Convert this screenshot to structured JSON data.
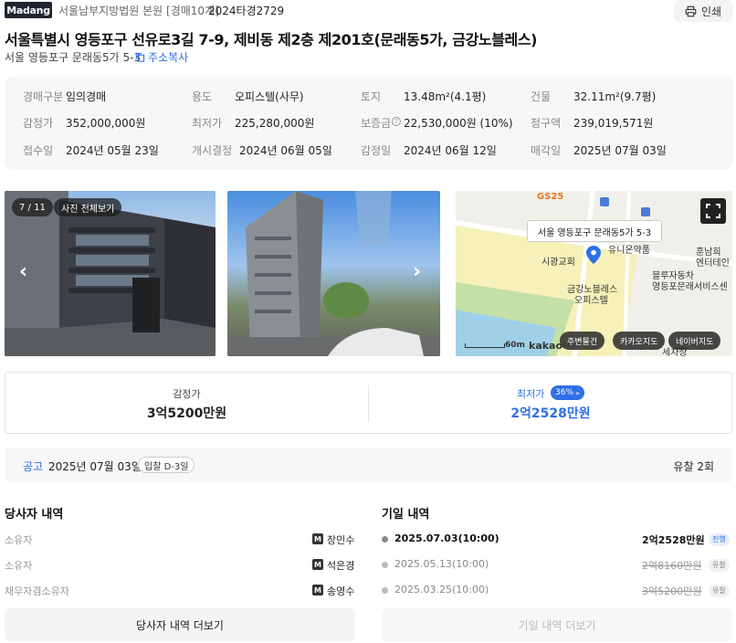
{
  "header": {
    "logo": "Madang",
    "court": "서울남부지방법원 본원 [경매10계]",
    "case_no": "2024타경2729",
    "print_label": "인쇄",
    "title": "서울특별시 영등포구 선유로3길 7-9, 제비동 제2층 제201호(문래동5가, 금강노블레스)",
    "sub_address": "서울 영등포구 문래동5가 5-3",
    "copy_label": "주소복사"
  },
  "info": [
    {
      "k": "경매구분",
      "v": "임의경매"
    },
    {
      "k": "용도",
      "v": "오피스텔(사무)"
    },
    {
      "k": "토지",
      "v": "13.48m²(4.1평)"
    },
    {
      "k": "건물",
      "v": "32.11m²(9.7평)"
    },
    {
      "k": "감정가",
      "v": "352,000,000원"
    },
    {
      "k": "최저가",
      "v": "225,280,000원"
    },
    {
      "k": "보증금",
      "v": "22,530,000원 (10%)"
    },
    {
      "k": "청구액",
      "v": "239,019,571원"
    },
    {
      "k": "접수일",
      "v": "2024년 05월 23일"
    },
    {
      "k": "개시결정",
      "v": "2024년 06월 05일"
    },
    {
      "k": "감정일",
      "v": "2024년 06월 12일"
    },
    {
      "k": "매각일",
      "v": "2025년 07월 03일"
    }
  ],
  "photos": {
    "counter": "7 / 11",
    "view_all": "사진 전체보기"
  },
  "map": {
    "tooltip": "서울 영등포구 문래동5가 5-3",
    "labels": [
      "GS25",
      "유니온약품",
      "시광교회",
      "금강노블레스",
      "오피스텔",
      "블루자동차",
      "영등포문래서비스센",
      "훈남희",
      "엔터테인",
      "세차장"
    ],
    "scale": "60m",
    "brand": "kakao",
    "buttons": [
      "주변물건",
      "카카오지도",
      "네이버지도"
    ]
  },
  "prices": {
    "appraisal_label": "감정가",
    "appraisal_value": "3억5200만원",
    "min_label": "최저가",
    "min_pct": "36%",
    "min_value": "2억2528만원"
  },
  "notice": {
    "label": "공고",
    "date": "2025년 07월 03일",
    "dday": "입찰 D-3일",
    "fail_count": "유찰 2회"
  },
  "parties": {
    "title": "당사자 내역",
    "rows": [
      {
        "role": "소유자",
        "name": "장민수"
      },
      {
        "role": "소유자",
        "name": "석은경"
      },
      {
        "role": "채무자겸소유자",
        "name": "송영수"
      }
    ],
    "more": "당사자 내역 더보기"
  },
  "schedule": {
    "title": "기일 내역",
    "rows": [
      {
        "date": "2025.07.03(10:00)",
        "price": "2억2528만원",
        "status": "진행"
      },
      {
        "date": "2025.05.13(10:00)",
        "price": "2억8160만원",
        "status": "유찰"
      },
      {
        "date": "2025.03.25(10:00)",
        "price": "3억5200만원",
        "status": "유찰"
      }
    ],
    "more": "기일 내역 더보기"
  },
  "colors": {
    "accent": "#2f6fe6",
    "dark": "#1f2430",
    "panel": "#f6f7f9"
  }
}
